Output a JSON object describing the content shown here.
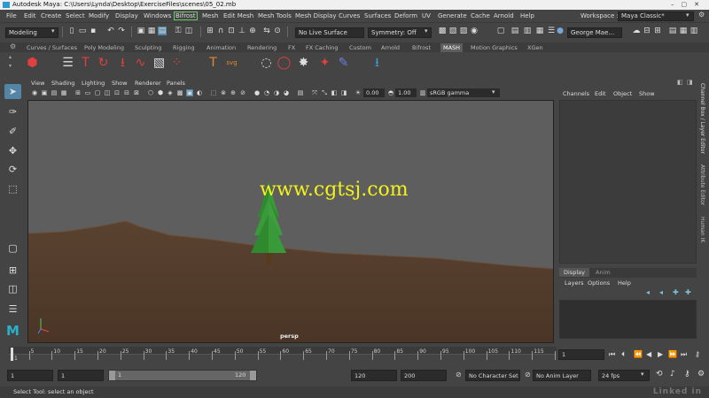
{
  "window": {
    "title": "Autodesk Maya: C:\\Users\\Lynda\\Desktop\\ExerciseFiles\\scenes\\05_02.mb"
  },
  "menubar": {
    "items": [
      "File",
      "Edit",
      "Create",
      "Select",
      "Modify",
      "Display",
      "Windows",
      "Bifrost",
      "Mesh",
      "Edit Mesh",
      "Mesh Tools",
      "Mesh Display",
      "Curves",
      "Surfaces",
      "Deform",
      "UV",
      "Generate",
      "Cache",
      "Arnold",
      "Help"
    ],
    "workspace_label": "Workspace :",
    "workspace_value": "Maya Classic*"
  },
  "statusline": {
    "mode": "Modeling",
    "live_surface": "No Live Surface",
    "symmetry": "Symmetry: Off",
    "user": "George Mae..."
  },
  "shelf": {
    "tabs": [
      "Curves / Surfaces",
      "Poly Modeling",
      "Sculpting",
      "Rigging",
      "Animation",
      "Rendering",
      "FX",
      "FX Caching",
      "Custom",
      "Arnold",
      "Bifrost",
      "MASH",
      "Motion Graphics",
      "XGen"
    ],
    "active_tab": "MASH"
  },
  "viewport": {
    "menus": [
      "View",
      "Shading",
      "Lighting",
      "Show",
      "Renderer",
      "Panels"
    ],
    "field_a": "0.00",
    "field_b": "1.00",
    "color_space": "sRGB gamma",
    "camera_label": "persp",
    "overlay_text": "www.cgtsj.com",
    "colors": {
      "sky": "#5e5e5e",
      "ground": "#5a4230",
      "tree": "#3a9a3a",
      "trunk": "#5a3a1a"
    }
  },
  "channelbox": {
    "menus": [
      "Channels",
      "Edit",
      "Object",
      "Show"
    ]
  },
  "layereditor": {
    "tabs": [
      "Display",
      "Anim"
    ],
    "menus": [
      "Layers",
      "Options",
      "Help"
    ]
  },
  "sidetabs": [
    "Channel Box / Layer Editor",
    "Attribute Editor",
    "Human IK"
  ],
  "timeslider": {
    "ticks": [
      "5",
      "10",
      "15",
      "20",
      "25",
      "30",
      "35",
      "40",
      "45",
      "50",
      "55",
      "60",
      "65",
      "70",
      "75",
      "80",
      "85",
      "90",
      "95",
      "100",
      "105",
      "110",
      "115",
      "120"
    ],
    "current_frame": "1",
    "current_frame_field": "1"
  },
  "rangeslider": {
    "start": "1",
    "playback_start": "1",
    "range_start_label": "1",
    "range_end_label": "120",
    "playback_end": "120",
    "end": "200",
    "character_set": "No Character Set",
    "anim_layer": "No Anim Layer",
    "fps": "24 fps"
  },
  "helpline": {
    "text": "Select Tool: select an object"
  },
  "watermark": "Linked in"
}
